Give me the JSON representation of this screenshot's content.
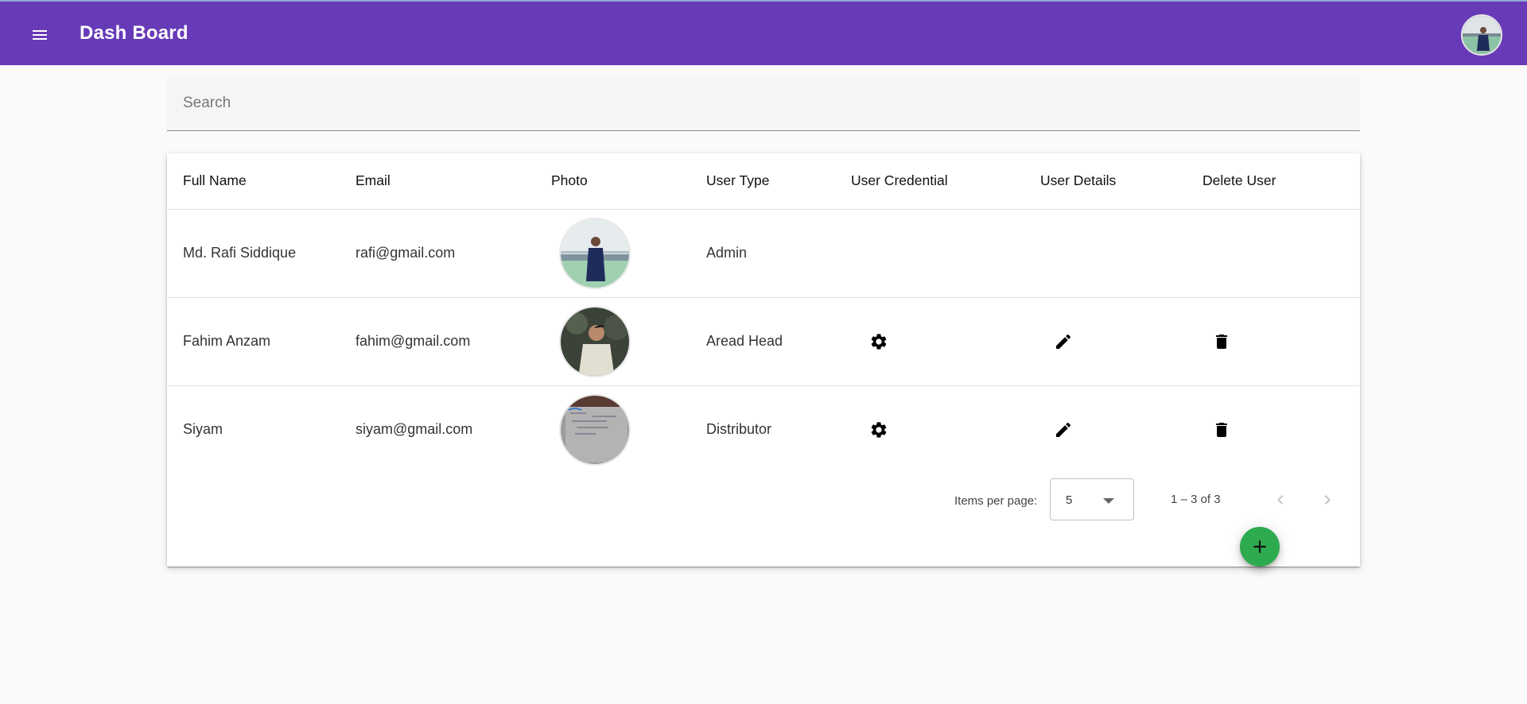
{
  "header": {
    "title": "Dash Board",
    "menu_icon": "menu-icon",
    "bg_color": "#673ab7"
  },
  "search": {
    "placeholder": "Search",
    "value": ""
  },
  "table": {
    "columns": [
      "Full Name",
      "Email",
      "Photo",
      "User Type",
      "User Credential",
      "User Details",
      "Delete User"
    ],
    "rows": [
      {
        "full_name": "Md. Rafi Siddique",
        "email": "rafi@gmail.com",
        "user_type": "Admin",
        "has_actions": false
      },
      {
        "full_name": "Fahim Anzam",
        "email": "fahim@gmail.com",
        "user_type": "Aread Head",
        "has_actions": true
      },
      {
        "full_name": "Siyam",
        "email": "siyam@gmail.com",
        "user_type": "Distributor",
        "has_actions": true
      }
    ],
    "action_icons": {
      "credential": "gear-icon",
      "details": "edit-icon",
      "delete": "trash-icon"
    }
  },
  "paginator": {
    "items_per_page_label": "Items per page:",
    "items_per_page_value": "5",
    "range_label": "1 – 3 of 3"
  },
  "fab": {
    "icon": "plus-icon",
    "color": "#2eaa4f"
  }
}
